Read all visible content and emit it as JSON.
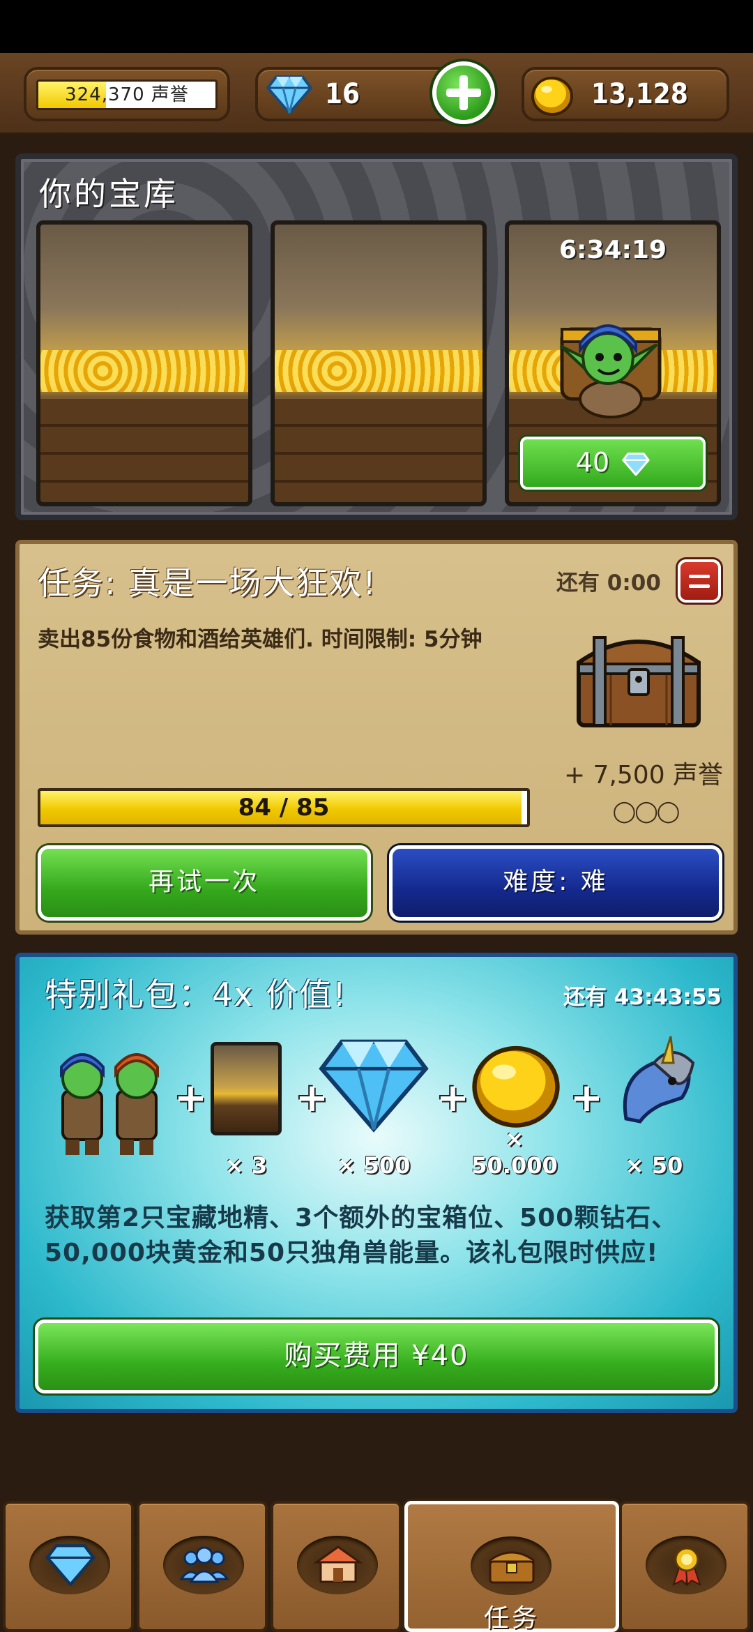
{
  "header": {
    "reputation": {
      "value_text": "324,370 声誉",
      "fill_fraction": 0.38
    },
    "gems": {
      "value": "16"
    },
    "gold": {
      "value": "13,128"
    }
  },
  "vault": {
    "title": "你的宝库",
    "slots": [
      {
        "state": "empty"
      },
      {
        "state": "empty"
      },
      {
        "state": "goblin",
        "timer": "6:34:19",
        "button_label": "40"
      }
    ]
  },
  "mission": {
    "title": "任务: 真是一场大狂欢!",
    "time_left": "还有 0:00",
    "description": "卖出85份食物和酒给英雄们. 时间限制: 5分钟",
    "reward": "+ 7,500 声誉",
    "reward_dots": "◯◯◯",
    "progress": {
      "text": "84 / 85",
      "current": 84,
      "total": 85
    },
    "retry_label": "再试一次",
    "difficulty_label": "难度: 难"
  },
  "offer": {
    "title": "特别礼包：4x 价值!",
    "time_left": "还有 43:43:55",
    "items": [
      {
        "icon": "goblin-pair-icon",
        "qty": ""
      },
      {
        "icon": "vault-slot-icon",
        "qty": "× 3"
      },
      {
        "icon": "diamond-icon",
        "qty": "× 500"
      },
      {
        "icon": "gold-coin-icon",
        "qty": "× 50.000"
      },
      {
        "icon": "unicorn-icon",
        "qty": "× 50"
      }
    ],
    "description": "获取第2只宝藏地精、3个额外的宝箱位、500颗钻石、50,000块黄金和50只独角兽能量。该礼包限时供应!",
    "buy_label": "购买费用 ¥40"
  },
  "nav": {
    "tabs": [
      {
        "icon": "diamond-icon",
        "label": ""
      },
      {
        "icon": "people-icon",
        "label": ""
      },
      {
        "icon": "shop-icon",
        "label": ""
      },
      {
        "icon": "chest-icon",
        "label": "任务",
        "active": true
      },
      {
        "icon": "medal-icon",
        "label": ""
      }
    ]
  },
  "colors": {
    "accent_green": "#35a81c",
    "accent_blue": "#14298e",
    "gold": "#f0c900",
    "wood": "#6a4423"
  }
}
